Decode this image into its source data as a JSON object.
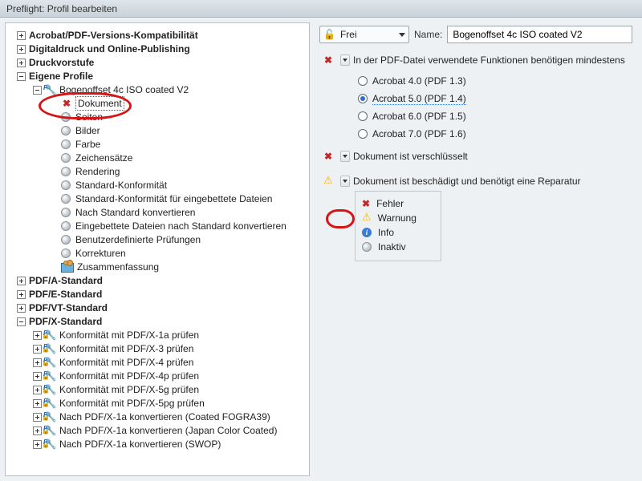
{
  "title": "Preflight: Profil bearbeiten",
  "tree": {
    "n0": "Acrobat/PDF-Versions-Kompatibilität",
    "n1": "Digitaldruck und Online-Publishing",
    "n2": "Druckvorstufe",
    "n3": "Eigene Profile",
    "n3_0": "Bogenoffset 4c ISO coated V2",
    "n3_0_0": "Dokument",
    "n3_0_1": "Seiten",
    "n3_0_2": "Bilder",
    "n3_0_3": "Farbe",
    "n3_0_4": "Zeichensätze",
    "n3_0_5": "Rendering",
    "n3_0_6": "Standard-Konformität",
    "n3_0_7": "Standard-Konformität für eingebettete Dateien",
    "n3_0_8": "Nach Standard konvertieren",
    "n3_0_9": "Eingebettete Dateien nach Standard konvertieren",
    "n3_0_10": "Benutzerdefinierte Prüfungen",
    "n3_0_11": "Korrekturen",
    "n3_0_12": "Zusammenfassung",
    "n4": "PDF/A-Standard",
    "n5": "PDF/E-Standard",
    "n6": "PDF/VT-Standard",
    "n7": "PDF/X-Standard",
    "n7_0": "Konformität mit PDF/X-1a prüfen",
    "n7_1": "Konformität mit PDF/X-3 prüfen",
    "n7_2": "Konformität mit PDF/X-4 prüfen",
    "n7_3": "Konformität mit PDF/X-4p prüfen",
    "n7_4": "Konformität mit PDF/X-5g prüfen",
    "n7_5": "Konformität mit PDF/X-5pg prüfen",
    "n7_6": "Nach PDF/X-1a konvertieren (Coated FOGRA39)",
    "n7_7": "Nach PDF/X-1a konvertieren (Japan Color Coated)",
    "n7_8": "Nach PDF/X-1a konvertieren (SWOP)"
  },
  "right": {
    "lock_combo": "Frei",
    "name_label": "Name:",
    "name_value": "Bogenoffset 4c ISO coated V2",
    "sec1": "In der PDF-Datei verwendete Funktionen benötigen mindestens",
    "radios": {
      "r0": "Acrobat 4.0 (PDF 1.3)",
      "r1": "Acrobat 5.0 (PDF 1.4)",
      "r2": "Acrobat 6.0 (PDF 1.5)",
      "r3": "Acrobat 7.0 (PDF 1.6)"
    },
    "sec2": "Dokument ist verschlüsselt",
    "sec3": "Dokument ist beschädigt und benötigt eine Reparatur",
    "legend": {
      "l0": "Fehler",
      "l1": "Warnung",
      "l2": "Info",
      "l3": "Inaktiv"
    }
  }
}
